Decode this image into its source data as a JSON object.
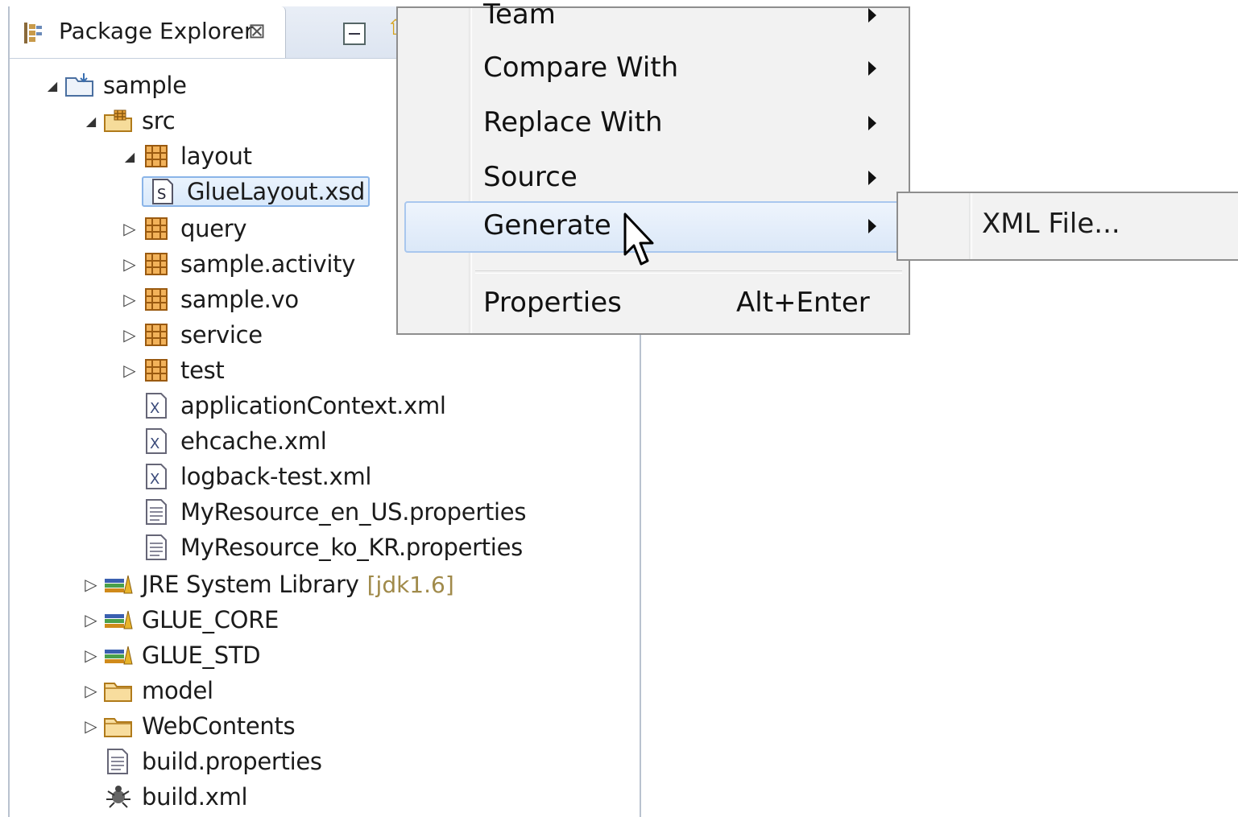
{
  "view": {
    "title": "Package Explorer",
    "close_glyph": "⊠",
    "icon": "package-explorer-icon",
    "toolbar": [
      "collapse-all-icon",
      "link-with-editor-icon"
    ]
  },
  "tree": [
    {
      "label": "sample",
      "icon": "project-folder-icon",
      "arrow": "◢",
      "expanded": true
    },
    {
      "label": "src",
      "icon": "source-folder-icon",
      "arrow": "◢",
      "expanded": true
    },
    {
      "label": "layout",
      "icon": "package-icon",
      "arrow": "◢",
      "expanded": true
    },
    {
      "label": "GlueLayout.xsd",
      "icon": "xsd-file-icon",
      "arrow": "",
      "selected": true
    },
    {
      "label": "query",
      "icon": "package-icon",
      "arrow": "▷"
    },
    {
      "label": "sample.activity",
      "icon": "package-icon",
      "arrow": "▷"
    },
    {
      "label": "sample.vo",
      "icon": "package-icon",
      "arrow": "▷"
    },
    {
      "label": "service",
      "icon": "package-icon",
      "arrow": "▷"
    },
    {
      "label": "test",
      "icon": "package-icon",
      "arrow": "▷"
    },
    {
      "label": "applicationContext.xml",
      "icon": "xml-file-icon",
      "arrow": ""
    },
    {
      "label": "ehcache.xml",
      "icon": "xml-file-icon",
      "arrow": ""
    },
    {
      "label": "logback-test.xml",
      "icon": "xml-file-icon",
      "arrow": ""
    },
    {
      "label": "MyResource_en_US.properties",
      "icon": "properties-file-icon",
      "arrow": ""
    },
    {
      "label": "MyResource_ko_KR.properties",
      "icon": "properties-file-icon",
      "arrow": ""
    },
    {
      "label": "JRE System Library",
      "extra": "[jdk1.6]",
      "icon": "library-icon",
      "arrow": "▷"
    },
    {
      "label": "GLUE_CORE",
      "icon": "library-icon",
      "arrow": "▷"
    },
    {
      "label": "GLUE_STD",
      "icon": "library-icon",
      "arrow": "▷"
    },
    {
      "label": "model",
      "icon": "folder-icon",
      "arrow": "▷"
    },
    {
      "label": "WebContents",
      "icon": "folder-icon",
      "arrow": "▷"
    },
    {
      "label": "build.properties",
      "icon": "properties-file-icon",
      "arrow": ""
    },
    {
      "label": "build.xml",
      "icon": "ant-file-icon",
      "arrow": ""
    }
  ],
  "context_menu": {
    "items": [
      {
        "label": "Team",
        "submenu": true
      },
      {
        "label": "Compare With",
        "submenu": true
      },
      {
        "label": "Replace With",
        "submenu": true
      },
      {
        "label": "Source",
        "submenu": true
      },
      {
        "label": "Generate",
        "submenu": true,
        "highlighted": true
      },
      {
        "label": "Properties",
        "accelerator": "Alt+Enter"
      }
    ]
  },
  "submenu": {
    "items": [
      {
        "label": "XML File..."
      }
    ]
  }
}
